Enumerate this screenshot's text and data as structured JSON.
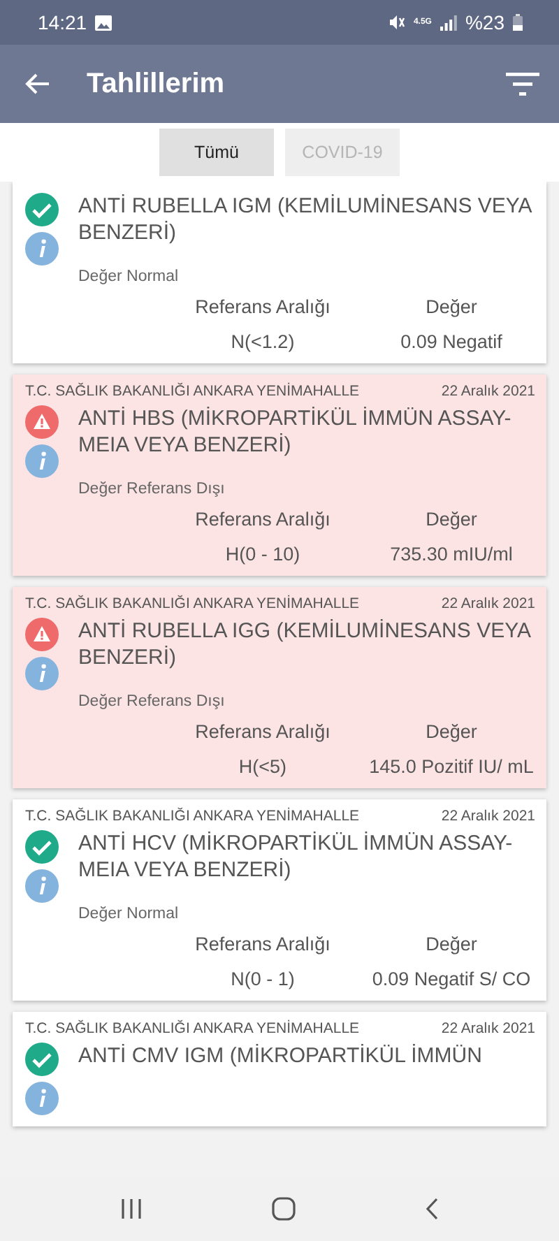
{
  "status_bar": {
    "time": "14:21",
    "network": "4.5G",
    "battery": "%23"
  },
  "app_bar": {
    "title": "Tahlillerim"
  },
  "tabs": [
    {
      "label": "Tümü",
      "selected": true
    },
    {
      "label": "COVID-19",
      "selected": false
    }
  ],
  "results": [
    {
      "kind": "normal",
      "title": "ANTİ RUBELLA IGM (KEMİLUMİNESANS VEYA BENZERİ)",
      "status_text": "Değer Normal",
      "range_label": "Referans Aralığı",
      "value_label": "Değer",
      "range": "N(<1.2)",
      "value": "0.09 Negatif"
    },
    {
      "kind": "out_of_range",
      "institution": "T.C. SAĞLIK BAKANLIĞI ANKARA YENİMAHALLE",
      "date": "22 Aralık 2021",
      "title": "ANTİ HBS  (MİKROPARTİKÜL İMMÜN ASSAY-MEIA VEYA BENZERİ)",
      "status_text": "Değer Referans Dışı",
      "range_label": "Referans Aralığı",
      "value_label": "Değer",
      "range": "H(0 - 10)",
      "value": "735.30 mIU/ml"
    },
    {
      "kind": "out_of_range",
      "institution": "T.C. SAĞLIK BAKANLIĞI ANKARA YENİMAHALLE",
      "date": "22 Aralık 2021",
      "title": "ANTİ RUBELLA IGG (KEMİLUMİNESANS VEYA BENZERİ)",
      "status_text": "Değer Referans Dışı",
      "range_label": "Referans Aralığı",
      "value_label": "Değer",
      "range": "H(<5)",
      "value": "145.0 Pozitif IU/ mL"
    },
    {
      "kind": "normal",
      "institution": "T.C. SAĞLIK BAKANLIĞI ANKARA YENİMAHALLE",
      "date": "22 Aralık 2021",
      "title": "ANTİ HCV (MİKROPARTİKÜL İMMÜN ASSAY-MEIA VEYA BENZERİ)",
      "status_text": "Değer Normal",
      "range_label": "Referans Aralığı",
      "value_label": "Değer",
      "range": "N(0 - 1)",
      "value": "0.09 Negatif S/ CO"
    },
    {
      "kind": "normal",
      "institution": "T.C. SAĞLIK BAKANLIĞI ANKARA YENİMAHALLE",
      "date": "22 Aralık 2021",
      "title": "ANTİ CMV IGM (MİKROPARTİKÜL İMMÜN"
    }
  ]
}
